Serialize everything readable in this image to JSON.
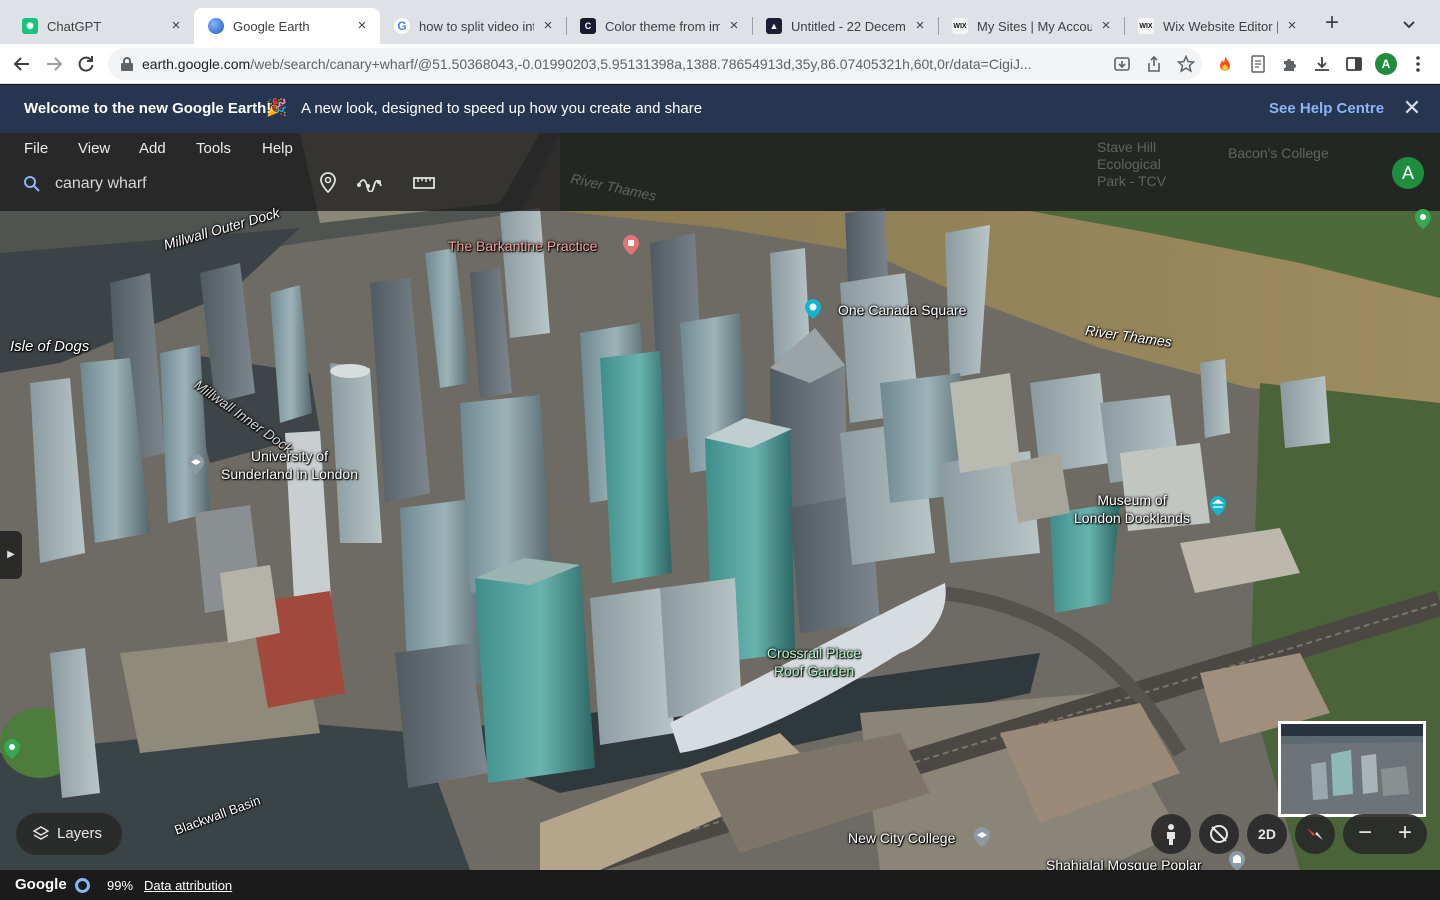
{
  "browser": {
    "tabs": [
      {
        "title": "ChatGPT",
        "favicon": "chatgpt-icon",
        "color": "#19c37d",
        "active": false
      },
      {
        "title": "Google Earth",
        "favicon": "google-earth-icon",
        "color": "#4285f4",
        "active": true
      },
      {
        "title": "how to split video int",
        "favicon": "google-icon",
        "color": "#ea4335",
        "active": false
      },
      {
        "title": "Color theme from im",
        "favicon": "colorapp-icon",
        "color": "#1a1a2e",
        "active": false
      },
      {
        "title": "Untitled - 22 Decem",
        "favicon": "adobe-express-icon",
        "color": "#1d1d35",
        "active": false
      },
      {
        "title": "My Sites | My Accour",
        "favicon": "wix-icon",
        "color": "#f5f5f5",
        "active": false
      },
      {
        "title": "Wix Website Editor |",
        "favicon": "wix-icon",
        "color": "#f5f5f5",
        "active": false
      }
    ],
    "url_host": "earth.google.com",
    "url_path": "/web/search/canary+wharf/@51.50368043,-0.01990203,5.95131398a,1388.78654913d,35y,86.07405321h,60t,0r/data=CigiJ...",
    "profile_initial": "A",
    "profile_color": "#1e8e3e"
  },
  "banner": {
    "title": "Welcome to the new Google Earth!",
    "emoji": "🎉",
    "text": "A new look, designed to speed up how you create and share",
    "link": "See Help Centre",
    "bg_color": "#273650"
  },
  "earth": {
    "menu": [
      "File",
      "View",
      "Add",
      "Tools",
      "Help"
    ],
    "search_value": "canary wharf",
    "avatar_initial": "A",
    "labels": {
      "isle_of_dogs": "Isle of Dogs",
      "millwall_outer": "Millwall Outer Dock",
      "millwall_inner": "Millwall Inner Dock",
      "barkantine": "The Barkantine Practice",
      "one_canada": "One Canada Square",
      "river_thames": "River Thames",
      "river_thames_top": "River Thames",
      "university": "University of\nSunderland in London",
      "museum": "Museum of\nLondon Docklands",
      "crossrail": "Crossrail Place\nRoof Garden",
      "blackwall": "Blackwall Basin",
      "new_city_college": "New City College",
      "shahjalal": "Shahjalal Mosque Poplar",
      "stave_hill": "Stave Hill\nEcological\nPark - TCV",
      "bacons": "Bacon's College"
    },
    "layers_label": "Layers",
    "view_2d_label": "2D"
  },
  "status": {
    "logo": "Google",
    "percent": "99%",
    "attribution": "Data attribution"
  }
}
